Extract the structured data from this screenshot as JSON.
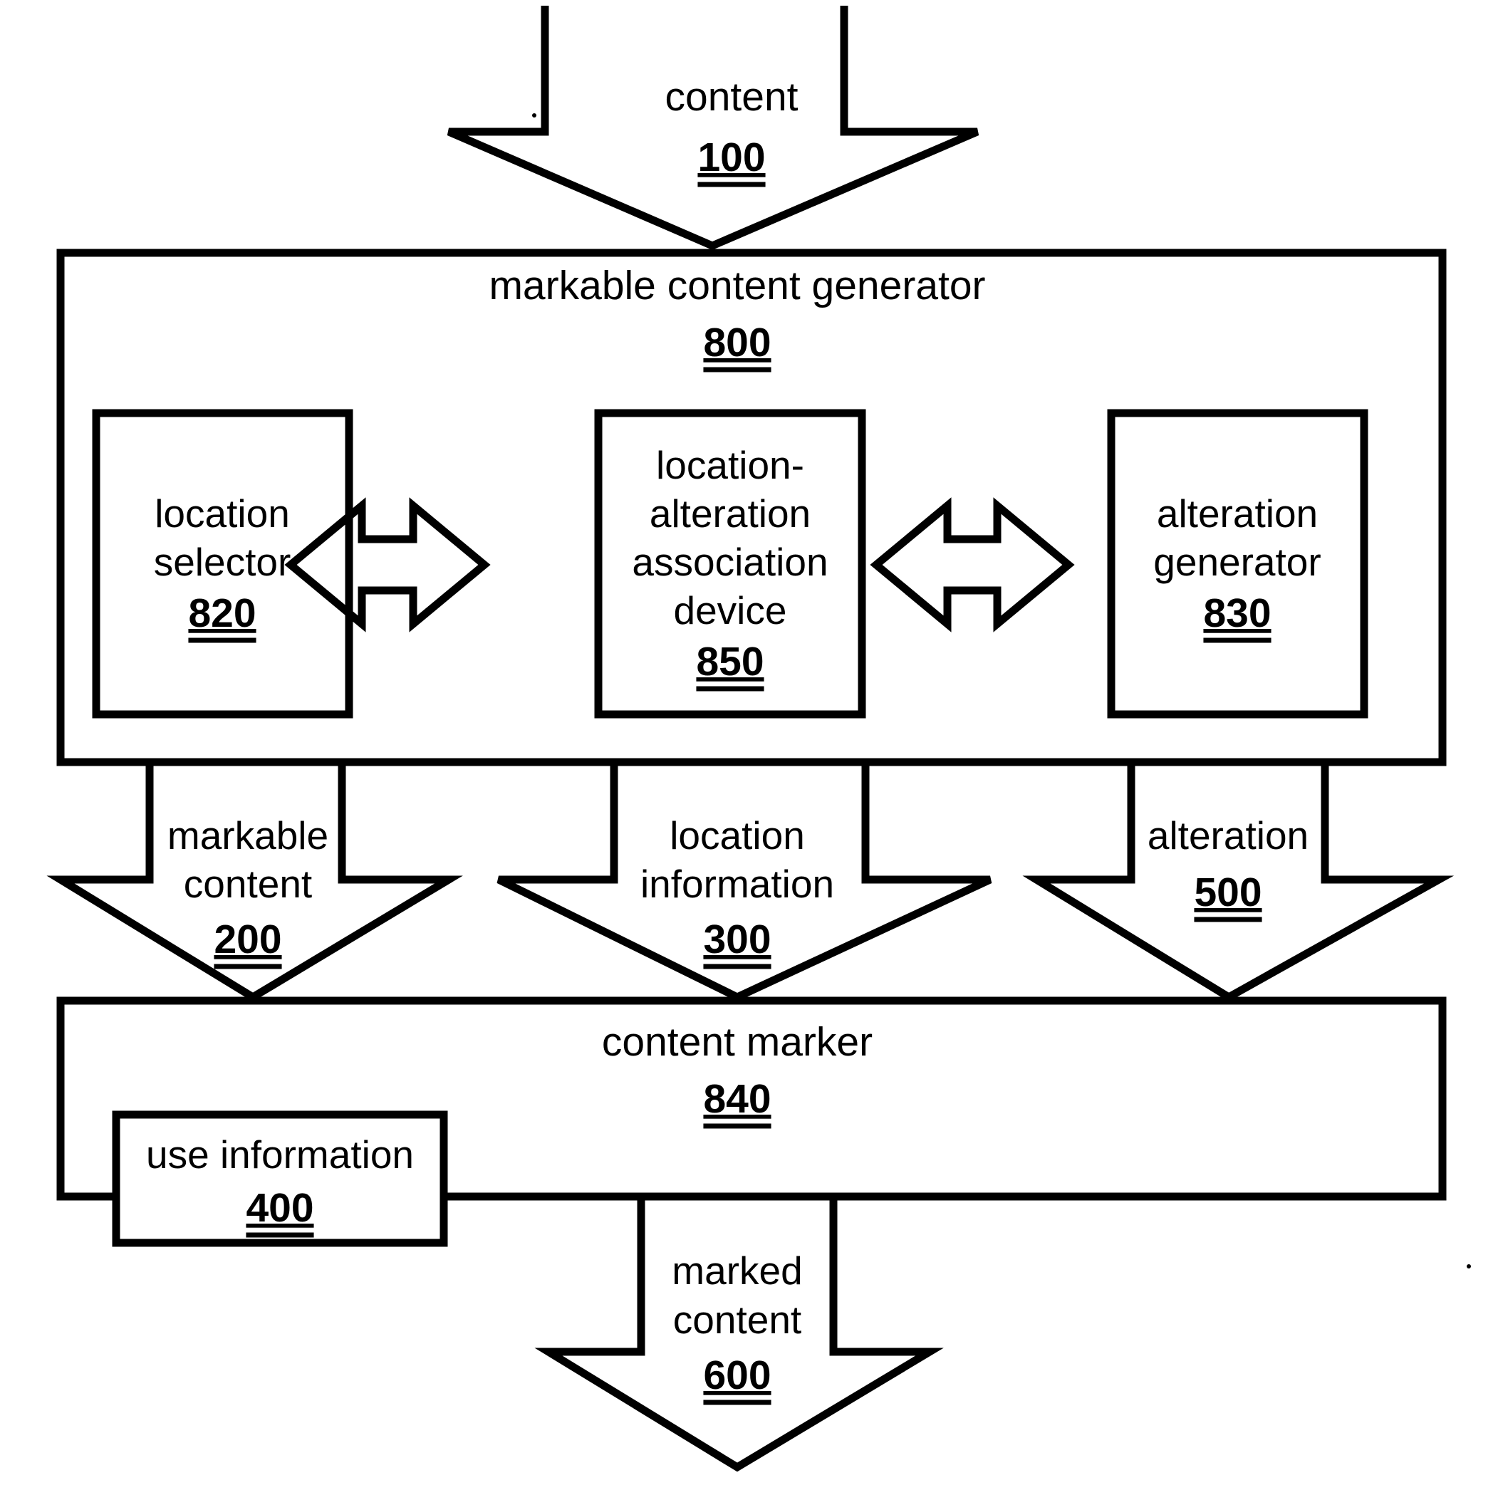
{
  "figure": {
    "title": "markable content generator block diagram",
    "line_color": "#000000",
    "background_color": "#ffffff"
  },
  "flow_in": {
    "label_line1": "content",
    "ref": "100"
  },
  "generator": {
    "title": "markable content generator",
    "ref": "800",
    "modules": [
      {
        "name": "location-selector",
        "lines": [
          "location",
          "selector"
        ],
        "ref": "820"
      },
      {
        "name": "location-alteration-association-device",
        "lines": [
          "location-",
          "alteration",
          "association",
          "device"
        ],
        "ref": "850"
      },
      {
        "name": "alteration-generator",
        "lines": [
          "alteration",
          "generator"
        ],
        "ref": "830"
      }
    ],
    "connectors": [
      {
        "name": "selector-to-association",
        "type": "double-headed-arrow"
      },
      {
        "name": "association-to-generator",
        "type": "double-headed-arrow"
      }
    ]
  },
  "outputs": [
    {
      "name": "markable-content",
      "lines": [
        "markable",
        "content"
      ],
      "ref": "200"
    },
    {
      "name": "location-information",
      "lines": [
        "location",
        "information"
      ],
      "ref": "300"
    },
    {
      "name": "alteration",
      "lines": [
        "alteration"
      ],
      "ref": "500"
    }
  ],
  "marker": {
    "title": "content marker",
    "ref": "840"
  },
  "use_information": {
    "title": "use information",
    "ref": "400"
  },
  "flow_out": {
    "lines": [
      "marked",
      "content"
    ],
    "ref": "600"
  }
}
